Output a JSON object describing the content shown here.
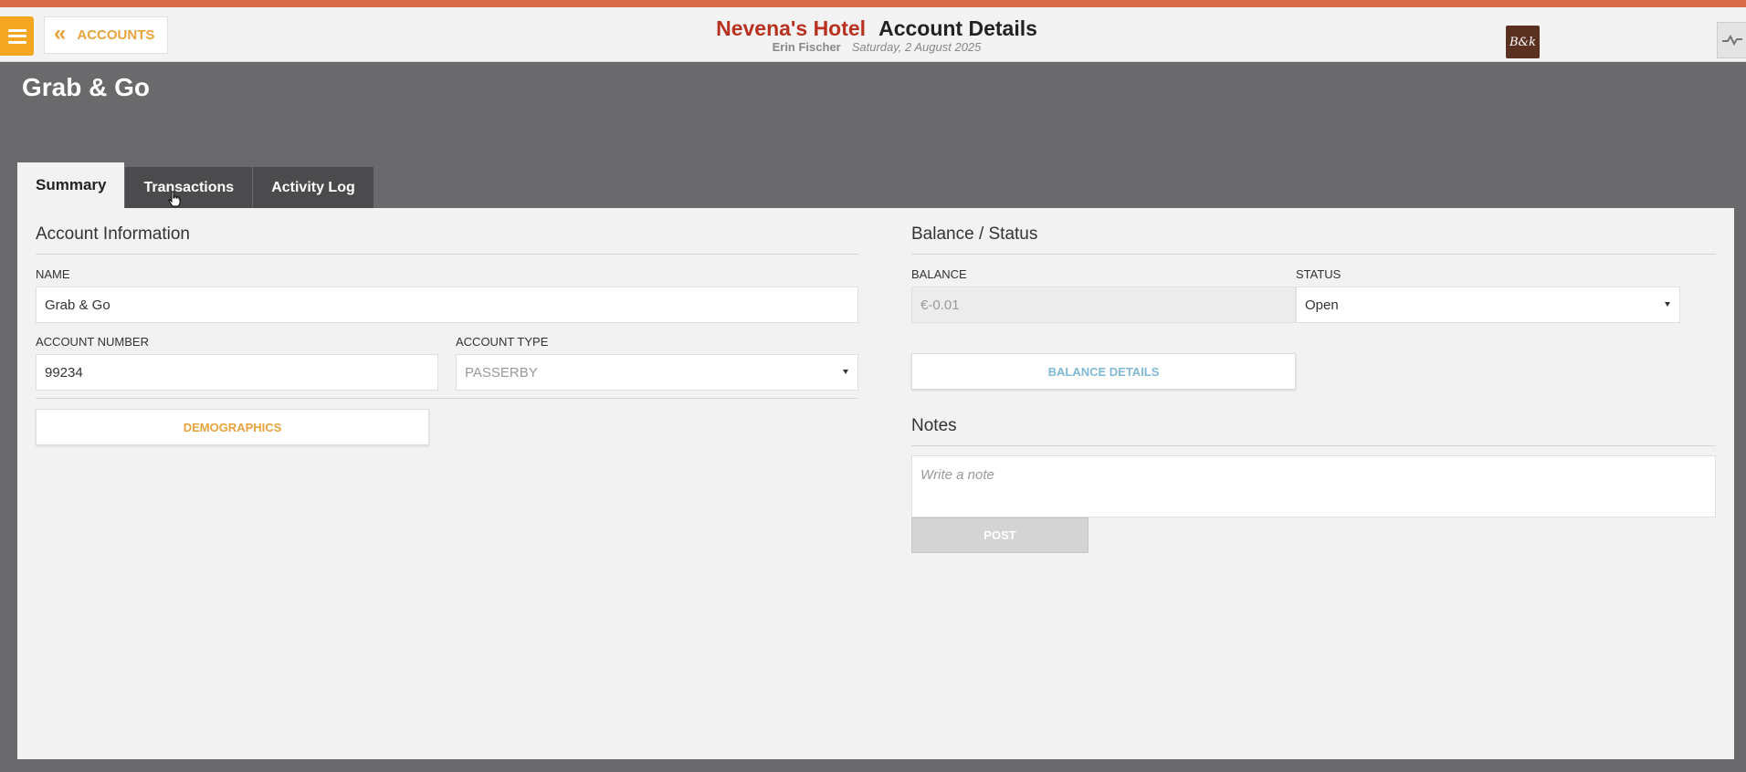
{
  "header": {
    "back_label": "ACCOUNTS",
    "hotel_name": "Nevena's Hotel",
    "page_title": "Account Details",
    "user_name": "Erin Fischer",
    "date": "Saturday, 2 August 2025",
    "logo_text": "B&k"
  },
  "account": {
    "title": "Grab & Go"
  },
  "tabs": [
    {
      "label": "Summary",
      "active": true
    },
    {
      "label": "Transactions",
      "active": false
    },
    {
      "label": "Activity Log",
      "active": false
    }
  ],
  "account_info": {
    "section_title": "Account Information",
    "name_label": "NAME",
    "name_value": "Grab & Go",
    "number_label": "ACCOUNT NUMBER",
    "number_value": "99234",
    "type_label": "ACCOUNT TYPE",
    "type_value": "PASSERBY",
    "demographics_label": "DEMOGRAPHICS"
  },
  "balance_status": {
    "section_title": "Balance / Status",
    "balance_label": "BALANCE",
    "balance_value": "€-0.01",
    "status_label": "STATUS",
    "status_value": "Open",
    "balance_details_label": "BALANCE DETAILS"
  },
  "notes": {
    "section_title": "Notes",
    "placeholder": "Write a note",
    "post_label": "POST"
  },
  "colors": {
    "accent_orange": "#f5a623",
    "hotel_red": "#b8321f",
    "link_blue": "#7fb9d6"
  }
}
